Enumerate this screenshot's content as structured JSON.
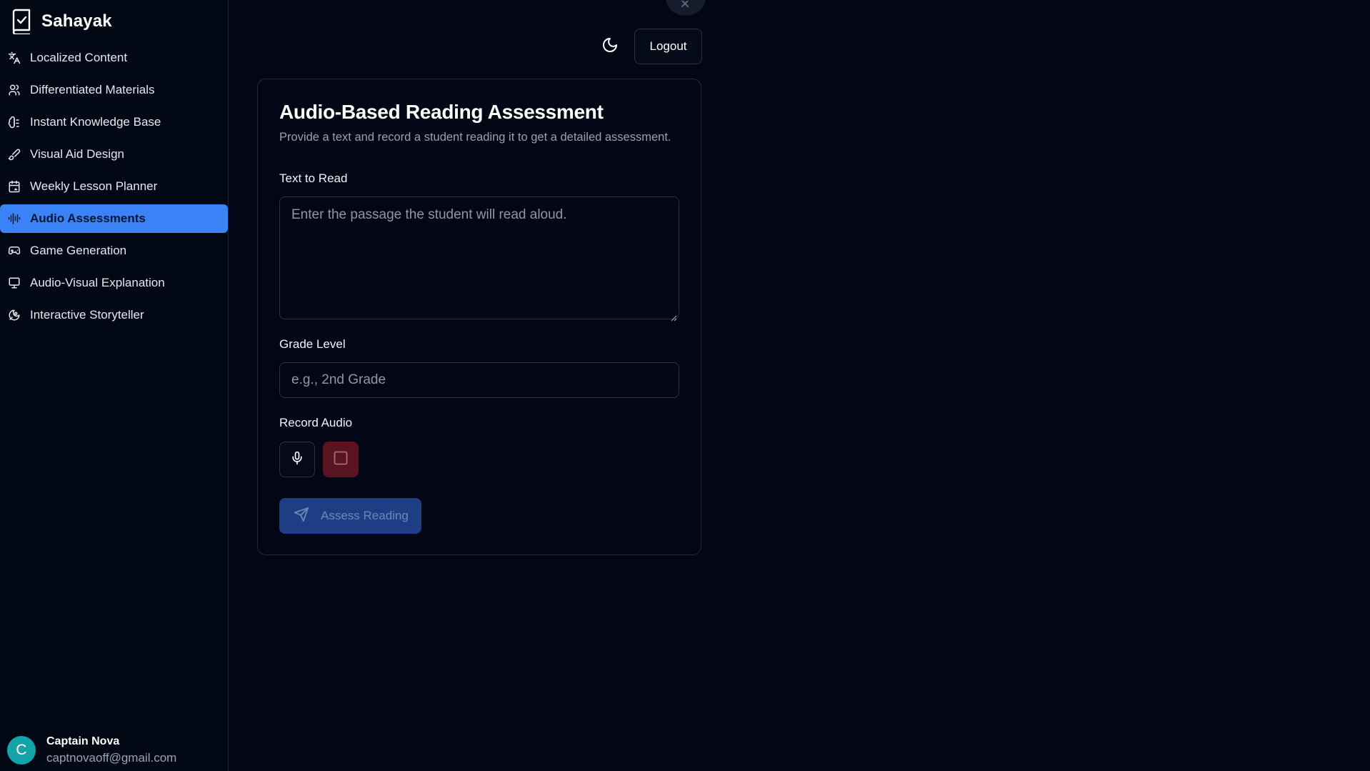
{
  "brand": {
    "name": "Sahayak",
    "icon": "book-check-icon"
  },
  "nav": {
    "items": [
      {
        "label": "Localized Content",
        "icon": "languages-icon",
        "active": false
      },
      {
        "label": "Differentiated Materials",
        "icon": "users-icon",
        "active": false
      },
      {
        "label": "Instant Knowledge Base",
        "icon": "brain-icon",
        "active": false
      },
      {
        "label": "Visual Aid Design",
        "icon": "brush-icon",
        "active": false
      },
      {
        "label": "Weekly Lesson Planner",
        "icon": "calendar-icon",
        "active": false
      },
      {
        "label": "Audio Assessments",
        "icon": "audio-lines-icon",
        "active": true
      },
      {
        "label": "Game Generation",
        "icon": "gamepad-icon",
        "active": false
      },
      {
        "label": "Audio-Visual Explanation",
        "icon": "presentation-icon",
        "active": false
      },
      {
        "label": "Interactive Storyteller",
        "icon": "sparkles-icon",
        "active": false
      }
    ]
  },
  "user": {
    "initial": "C",
    "name": "Captain Nova",
    "email": "captnovaoff@gmail.com"
  },
  "header": {
    "logout_label": "Logout",
    "theme_icon": "moon-icon"
  },
  "form": {
    "title": "Audio-Based Reading Assessment",
    "description": "Provide a text and record a student reading it to get a detailed assessment.",
    "text_label": "Text to Read",
    "text_placeholder": "Enter the passage the student will read aloud.",
    "grade_label": "Grade Level",
    "grade_placeholder": "e.g., 2nd Grade",
    "record_label": "Record Audio",
    "submit_label": "Assess Reading"
  },
  "colors": {
    "accent": "#3b82f6",
    "background": "#030614",
    "stop_button": "#5a1320",
    "submit_disabled": "#1d3e84",
    "avatar": "#14a3a8"
  }
}
